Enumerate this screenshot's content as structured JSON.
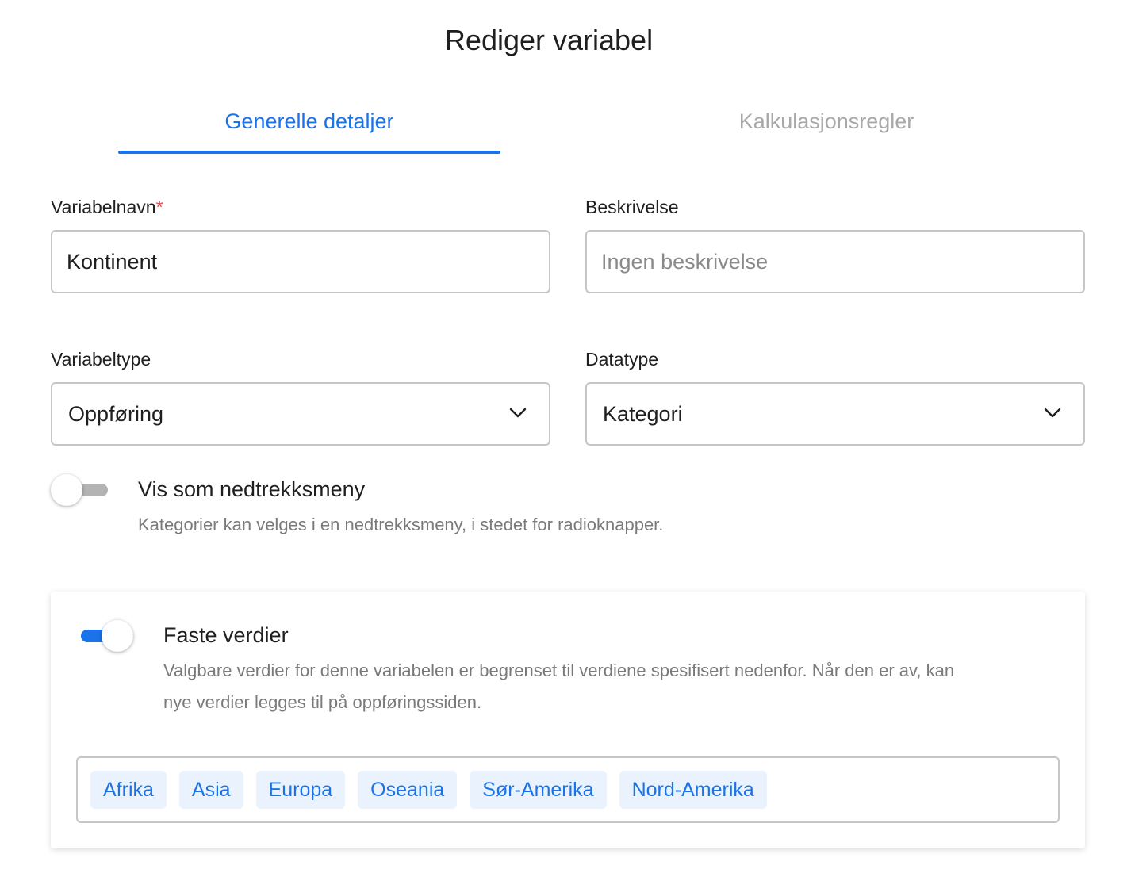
{
  "dialog": {
    "title": "Rediger variabel"
  },
  "tabs": [
    {
      "label": "Generelle detaljer",
      "active": true
    },
    {
      "label": "Kalkulasjonsregler",
      "active": false
    }
  ],
  "fields": {
    "name": {
      "label": "Variabelnavn",
      "required_mark": "*",
      "value": "Kontinent"
    },
    "description": {
      "label": "Beskrivelse",
      "value": "",
      "placeholder": "Ingen beskrivelse"
    },
    "variable_type": {
      "label": "Variabeltype",
      "selected": "Oppføring",
      "icon": "chevron-down-icon"
    },
    "data_type": {
      "label": "Datatype",
      "selected": "Kategori",
      "icon": "chevron-down-icon"
    }
  },
  "dropdown_option": {
    "title": "Vis som nedtrekksmeny",
    "description": "Kategorier kan velges i en nedtrekksmeny, i stedet for radioknapper.",
    "enabled": false
  },
  "fixed_values": {
    "title": "Faste verdier",
    "description_line1": "Valgbare verdier for denne variabelen er begrenset til verdiene spesifisert nedenfor. Når den er av, kan",
    "description_line2": "nye verdier legges til på oppføringssiden.",
    "enabled": true,
    "values": [
      "Afrika",
      "Asia",
      "Europa",
      "Oseania",
      "Sør-Amerika",
      "Nord-Amerika"
    ]
  },
  "colors": {
    "accent": "#1a73e8",
    "chip_background": "#eaf3fd",
    "required": "#e5484d",
    "inactive_tab": "#a8a8a8"
  }
}
